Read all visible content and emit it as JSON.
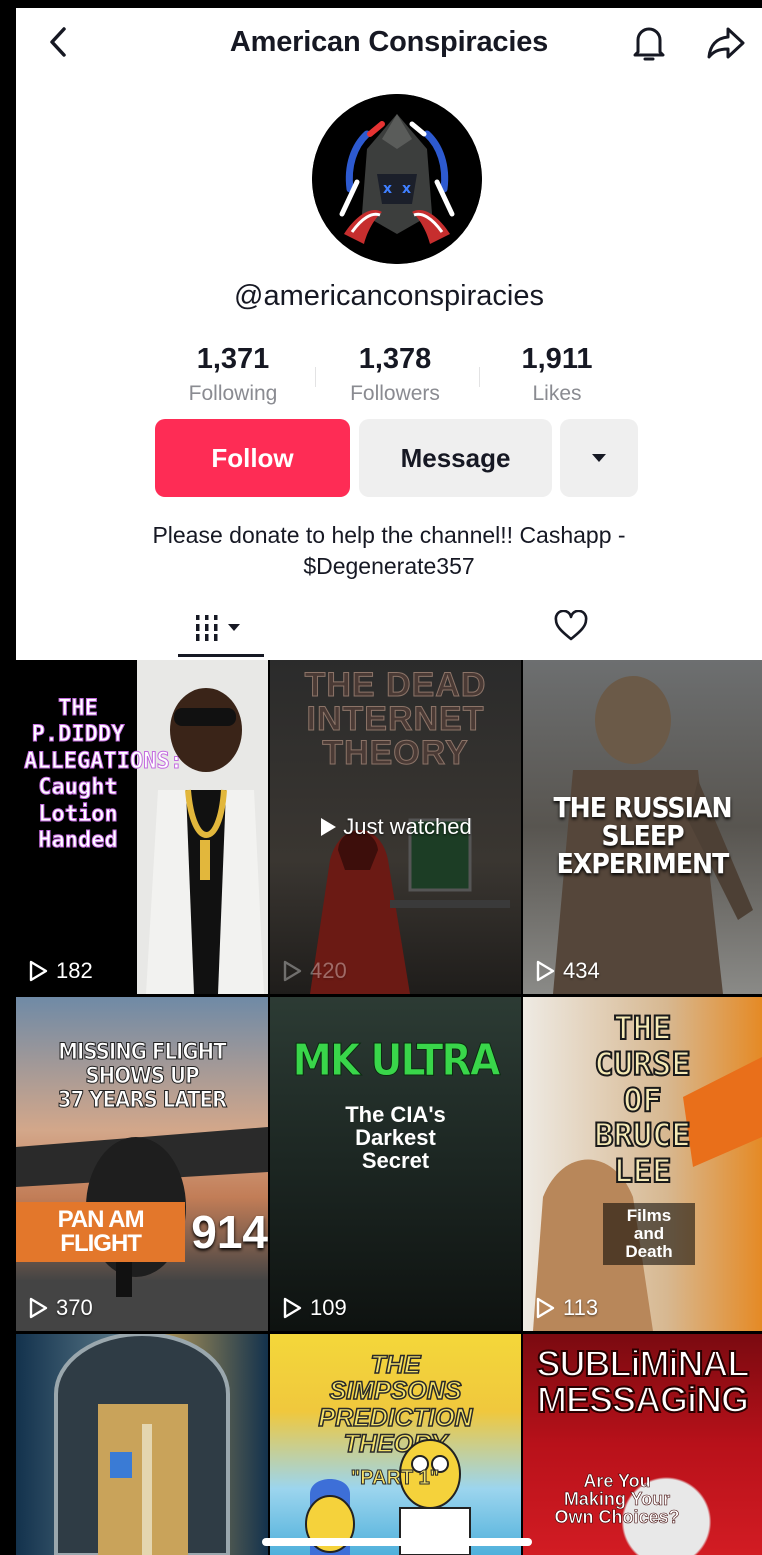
{
  "header": {
    "title": "American Conspiracies",
    "back_icon": "chevron-left-icon",
    "bell_icon": "bell-icon",
    "share_icon": "share-arrow-icon"
  },
  "profile": {
    "handle": "@americanconspiracies",
    "stats": [
      {
        "value": "1,371",
        "label": "Following"
      },
      {
        "value": "1,378",
        "label": "Followers"
      },
      {
        "value": "1,911",
        "label": "Likes"
      }
    ],
    "follow_label": "Follow",
    "message_label": "Message",
    "bio_line1": "Please donate to help the channel!! Cashapp -",
    "bio_line2": "$Degenerate357"
  },
  "colors": {
    "accent": "#fe2c55",
    "button_gray": "#efefef"
  },
  "grid": [
    {
      "views": "182",
      "cover_text": [
        "THE",
        "P.DIDDY",
        "ALLEGATIONS:",
        "Caught",
        "Lotion",
        "Handed"
      ]
    },
    {
      "views": "420",
      "cover_text": [
        "THE DEAD",
        "INTERNET",
        "THEORY"
      ],
      "overlay": "Just watched"
    },
    {
      "views": "434",
      "cover_text": [
        "THE RUSSIAN",
        "SLEEP EXPERIMENT"
      ]
    },
    {
      "views": "370",
      "cover_text": [
        "MISSING FLIGHT",
        "SHOWS UP",
        "37 YEARS LATER"
      ],
      "caption": "PAN AM FLIGHT",
      "caption_number": "914"
    },
    {
      "views": "109",
      "cover_text": [
        "MK ULTRA"
      ],
      "subtitle": [
        "The CIA's",
        "Darkest",
        "Secret"
      ]
    },
    {
      "views": "113",
      "cover_text": [
        "THE",
        "CURSE",
        "OF",
        "BRUCE",
        "LEE"
      ],
      "subtitle": [
        "Films",
        "and",
        "Death"
      ]
    },
    {
      "views": "",
      "cover_text": []
    },
    {
      "views": "",
      "cover_text": [
        "THE",
        "SIMPSONS",
        "PREDICTION",
        "THEORY"
      ],
      "subtitle": [
        "\"PART 1\""
      ]
    },
    {
      "views": "",
      "cover_text": [
        "SUBLiMiNAL",
        "MESSAGiNG"
      ],
      "subtitle": [
        "Are You",
        "Making Your",
        "Own Choices?"
      ]
    }
  ]
}
